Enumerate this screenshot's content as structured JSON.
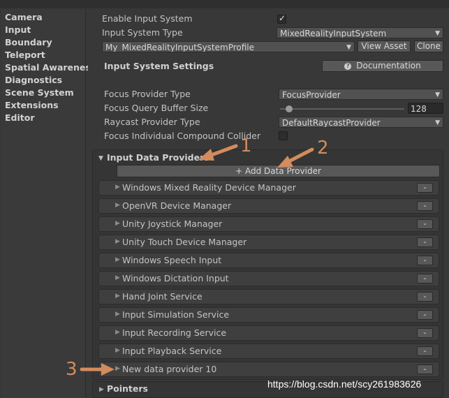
{
  "nav": {
    "items": [
      "Camera",
      "Input",
      "Boundary",
      "Teleport",
      "Spatial Awareness",
      "Diagnostics",
      "Scene System",
      "Extensions",
      "Editor"
    ]
  },
  "input": {
    "enable_label": "Enable Input System",
    "enable_checked": true,
    "type_label": "Input System Type",
    "type_value": "MixedRealityInputSystem",
    "profile_value": "My_MixedRealityInputSystemProfile",
    "view_asset": "View Asset",
    "clone": "Clone",
    "settings_heading": "Input System Settings",
    "documentation": "Documentation",
    "focus_provider_label": "Focus Provider Type",
    "focus_provider_value": "FocusProvider",
    "focus_buffer_label": "Focus Query Buffer Size",
    "focus_buffer_value": "128",
    "raycast_label": "Raycast Provider Type",
    "raycast_value": "DefaultRaycastProvider",
    "compound_label": "Focus Individual Compound Collider",
    "compound_checked": false
  },
  "providers": {
    "heading": "Input Data Providers",
    "add_button": "+ Add Data Provider",
    "remove_label": "-",
    "items": [
      "Windows Mixed Reality Device Manager",
      "OpenVR Device Manager",
      "Unity Joystick Manager",
      "Unity Touch Device Manager",
      "Windows Speech Input",
      "Windows Dictation Input",
      "Hand Joint Service",
      "Input Simulation Service",
      "Input Recording Service",
      "Input Playback Service",
      "New data provider 10"
    ]
  },
  "pointers": {
    "heading": "Pointers"
  },
  "annotations": {
    "one": "1",
    "two": "2",
    "three": "3",
    "color": "#d38c5e"
  },
  "watermark": "https://blog.csdn.net/scy261983626"
}
